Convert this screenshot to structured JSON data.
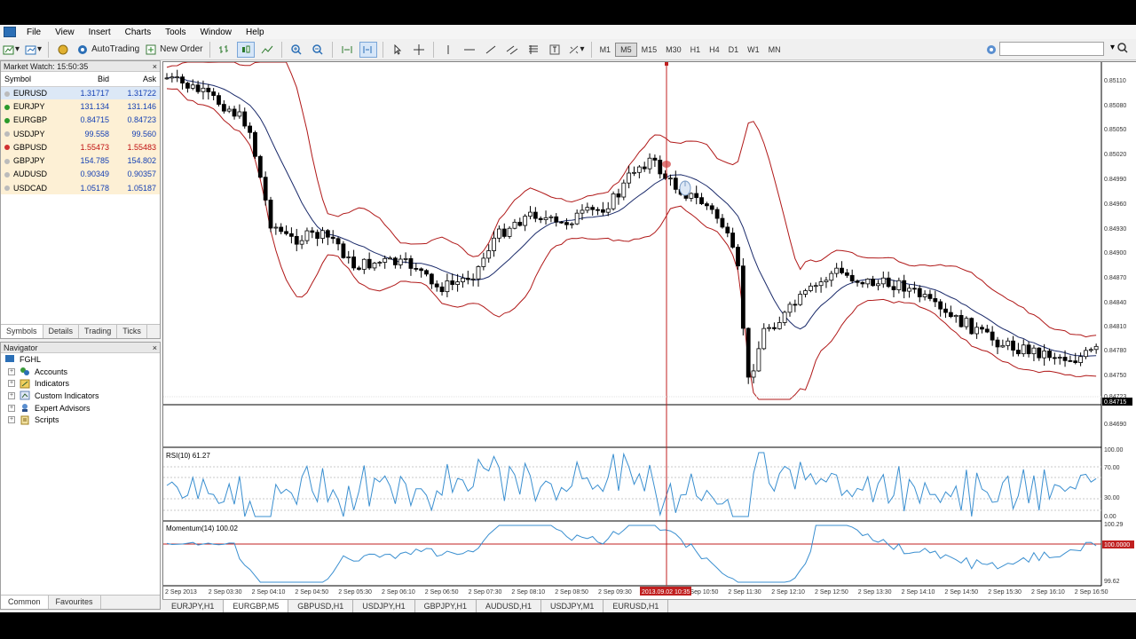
{
  "menu": [
    "File",
    "View",
    "Insert",
    "Charts",
    "Tools",
    "Window",
    "Help"
  ],
  "toolbar": {
    "autotrading_label": "AutoTrading",
    "new_order_label": "New Order",
    "timeframes": [
      "M1",
      "M5",
      "M15",
      "M30",
      "H1",
      "H4",
      "D1",
      "W1",
      "MN"
    ],
    "active_timeframe": "M5"
  },
  "market_watch": {
    "title": "Market Watch: 15:50:35",
    "columns": [
      "Symbol",
      "Bid",
      "Ask"
    ],
    "rows": [
      {
        "symbol": "EURUSD",
        "bid": "1.31717",
        "ask": "1.31722",
        "dir": "none"
      },
      {
        "symbol": "EURJPY",
        "bid": "131.134",
        "ask": "131.146",
        "dir": "up"
      },
      {
        "symbol": "EURGBP",
        "bid": "0.84715",
        "ask": "0.84723",
        "dir": "up"
      },
      {
        "symbol": "USDJPY",
        "bid": "99.558",
        "ask": "99.560",
        "dir": "none"
      },
      {
        "symbol": "GBPUSD",
        "bid": "1.55473",
        "ask": "1.55483",
        "dir": "down"
      },
      {
        "symbol": "GBPJPY",
        "bid": "154.785",
        "ask": "154.802",
        "dir": "none"
      },
      {
        "symbol": "AUDUSD",
        "bid": "0.90349",
        "ask": "0.90357",
        "dir": "none"
      },
      {
        "symbol": "USDCAD",
        "bid": "1.05178",
        "ask": "1.05187",
        "dir": "none"
      }
    ],
    "tabs": [
      "Symbols",
      "Details",
      "Trading",
      "Ticks"
    ]
  },
  "navigator": {
    "title": "Navigator",
    "root": "FGHL",
    "items": [
      "Accounts",
      "Indicators",
      "Custom Indicators",
      "Expert Advisors",
      "Scripts"
    ],
    "tabs": [
      "Common",
      "Favourites"
    ]
  },
  "chart": {
    "price_labels": [
      "0.85110",
      "0.85080",
      "0.85050",
      "0.85020",
      "0.84990",
      "0.84960",
      "0.84930",
      "0.84900",
      "0.84870",
      "0.84840",
      "0.84810",
      "0.84780",
      "0.84750",
      "0.84723",
      "0.84715",
      "0.84690"
    ],
    "current_price": "0.84715",
    "rsi_label": "RSI(10) 61.27",
    "rsi_levels": [
      "100.00",
      "70.00",
      "30.00",
      "0.00"
    ],
    "momentum_label": "Momentum(14) 100.02",
    "momentum_levels": [
      "100.29",
      "100.0000",
      "99.62"
    ],
    "time_labels": [
      "2 Sep 2013",
      "2 Sep 03:30",
      "2 Sep 04:10",
      "2 Sep 04:50",
      "2 Sep 05:30",
      "2 Sep 06:10",
      "2 Sep 06:50",
      "2 Sep 07:30",
      "2 Sep 08:10",
      "2 Sep 08:50",
      "2 Sep 09:30",
      "2 Sep 10:50",
      "2 Sep 11:30",
      "2 Sep 12:10",
      "2 Sep 12:50",
      "2 Sep 13:30",
      "2 Sep 14:10",
      "2 Sep 14:50",
      "2 Sep 15:30",
      "2 Sep 16:10",
      "2 Sep 16:50"
    ],
    "crosshair_time": "2013.09.02 10:35",
    "colors": {
      "band": "#b01818",
      "ma": "#1a2a6a",
      "rsi": "#3a8fd0",
      "momentum": "#3a8fd0",
      "crosshair": "#c02020",
      "level": "#c02020"
    }
  },
  "chart_tabs": [
    "EURJPY,H1",
    "EURGBP,M5",
    "GBPUSD,H1",
    "USDJPY,H1",
    "GBPJPY,H1",
    "AUDUSD,H1",
    "USDJPY,M1",
    "EURUSD,H1"
  ],
  "active_chart_tab": "EURGBP,M5"
}
